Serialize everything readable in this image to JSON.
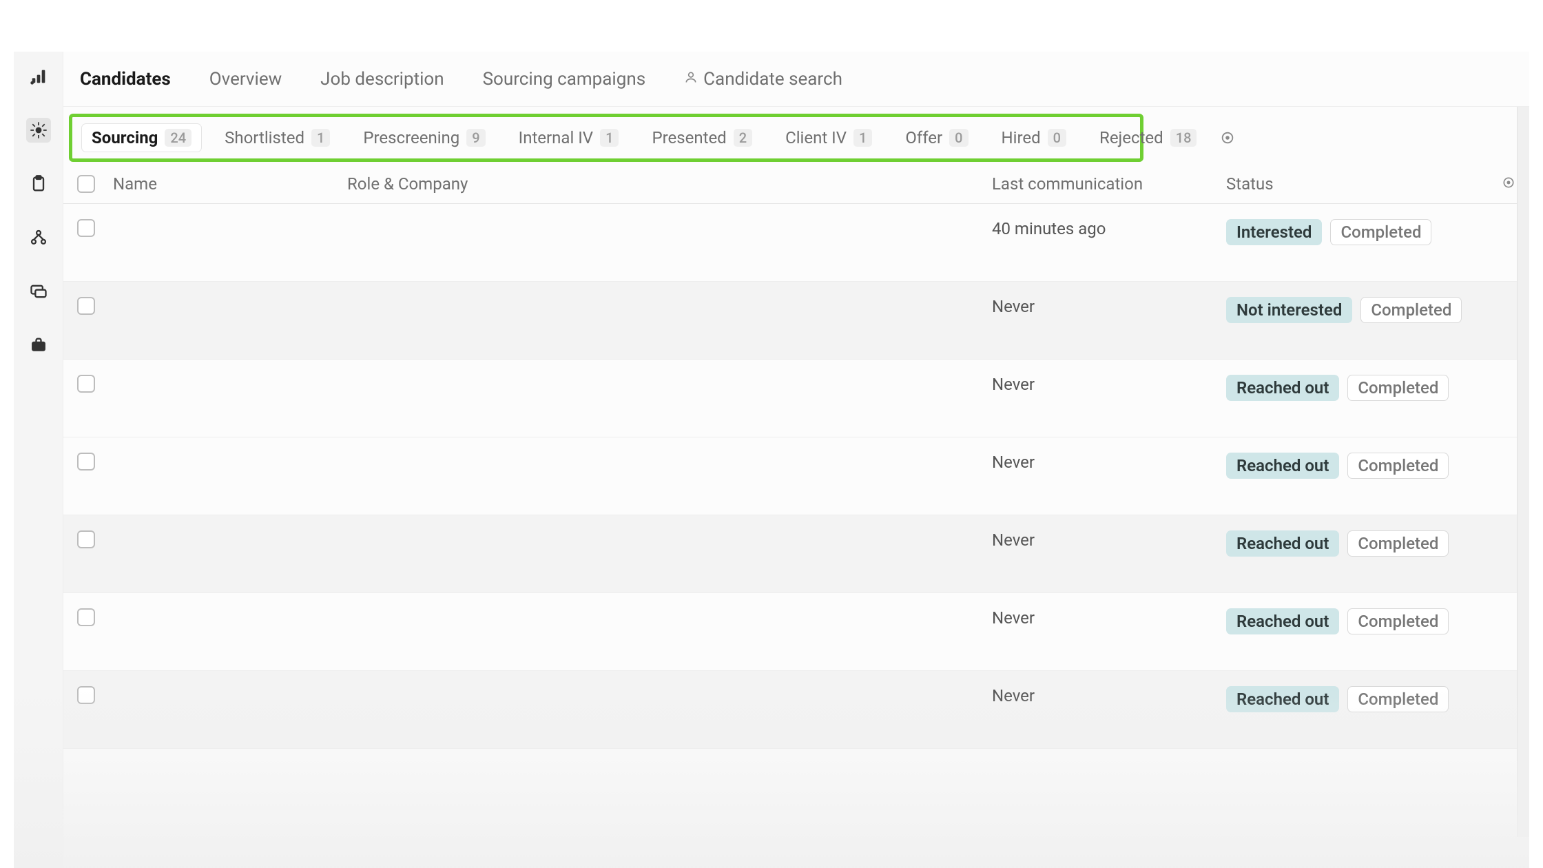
{
  "sidebar": {
    "items": [
      {
        "name": "logo"
      },
      {
        "name": "burst"
      },
      {
        "name": "clipboard"
      },
      {
        "name": "org"
      },
      {
        "name": "messages"
      },
      {
        "name": "briefcase"
      }
    ],
    "active_index": 1
  },
  "top_tabs": {
    "items": [
      {
        "label": "Candidates",
        "active": true
      },
      {
        "label": "Overview"
      },
      {
        "label": "Job description"
      },
      {
        "label": "Sourcing campaigns"
      },
      {
        "label": "Candidate search",
        "icon": "person"
      }
    ]
  },
  "stages": {
    "highlight_color": "#6fcf32",
    "items": [
      {
        "label": "Sourcing",
        "count": "24",
        "active": true
      },
      {
        "label": "Shortlisted",
        "count": "1"
      },
      {
        "label": "Prescreening",
        "count": "9"
      },
      {
        "label": "Internal IV",
        "count": "1"
      },
      {
        "label": "Presented",
        "count": "2"
      },
      {
        "label": "Client IV",
        "count": "1"
      },
      {
        "label": "Offer",
        "count": "0"
      },
      {
        "label": "Hired",
        "count": "0"
      },
      {
        "label": "Rejected",
        "count": "18"
      }
    ]
  },
  "table": {
    "headers": {
      "name": "Name",
      "role": "Role & Company",
      "last": "Last communication",
      "status": "Status"
    },
    "rows": [
      {
        "last": "40 minutes ago",
        "status1": "Interested",
        "status2": "Completed",
        "alt": false
      },
      {
        "last": "Never",
        "status1": "Not interested",
        "status2": "Completed",
        "alt": true
      },
      {
        "last": "Never",
        "status1": "Reached out",
        "status2": "Completed",
        "alt": false
      },
      {
        "last": "Never",
        "status1": "Reached out",
        "status2": "Completed",
        "alt": false
      },
      {
        "last": "Never",
        "status1": "Reached out",
        "status2": "Completed",
        "alt": true
      },
      {
        "last": "Never",
        "status1": "Reached out",
        "status2": "Completed",
        "alt": false
      },
      {
        "last": "Never",
        "status1": "Reached out",
        "status2": "Completed",
        "alt": true
      }
    ]
  }
}
